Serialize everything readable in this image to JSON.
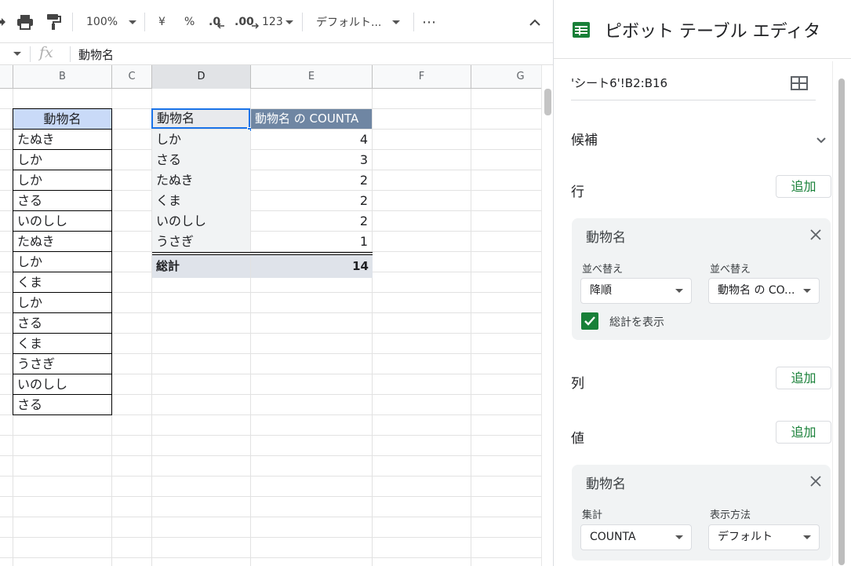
{
  "toolbar": {
    "zoom": "100%",
    "currency": "¥",
    "percent": "%",
    "decrease_decimal": ".0",
    "increase_decimal": ".00",
    "number_format": "123",
    "font": "デフォルト...",
    "more": "⋯"
  },
  "formula_bar": {
    "fx": "fx",
    "content": "動物名"
  },
  "columns": [
    "B",
    "C",
    "D",
    "E",
    "F",
    "G"
  ],
  "source_table": {
    "header": "動物名",
    "rows": [
      "たぬき",
      "しか",
      "しか",
      "さる",
      "いのしし",
      "たぬき",
      "しか",
      "くま",
      "しか",
      "さる",
      "くま",
      "うさぎ",
      "いのしし",
      "さる"
    ]
  },
  "pivot_table": {
    "header_label": "動物名",
    "header_value": "動物名 の COUNTA",
    "rows": [
      {
        "label": "しか",
        "value": "4"
      },
      {
        "label": "さる",
        "value": "3"
      },
      {
        "label": "たぬき",
        "value": "2"
      },
      {
        "label": "くま",
        "value": "2"
      },
      {
        "label": "いのしし",
        "value": "2"
      },
      {
        "label": "うさぎ",
        "value": "1"
      }
    ],
    "total_label": "総計",
    "total_value": "14"
  },
  "panel": {
    "title": "ピボット テーブル エディタ",
    "range": "'シート6'!B2:B16",
    "suggestions": "候補",
    "rows_label": "行",
    "columns_label": "列",
    "values_label": "値",
    "add": "追加",
    "row_card": {
      "title": "動物名",
      "order_label": "並べ替え",
      "order_value": "降順",
      "sortby_label": "並べ替え",
      "sortby_value": "動物名 の CO...",
      "show_totals": "総計を表示"
    },
    "value_card": {
      "title": "動物名",
      "summarize_label": "集計",
      "summarize_value": "COUNTA",
      "show_as_label": "表示方法",
      "show_as_value": "デフォルト"
    }
  }
}
